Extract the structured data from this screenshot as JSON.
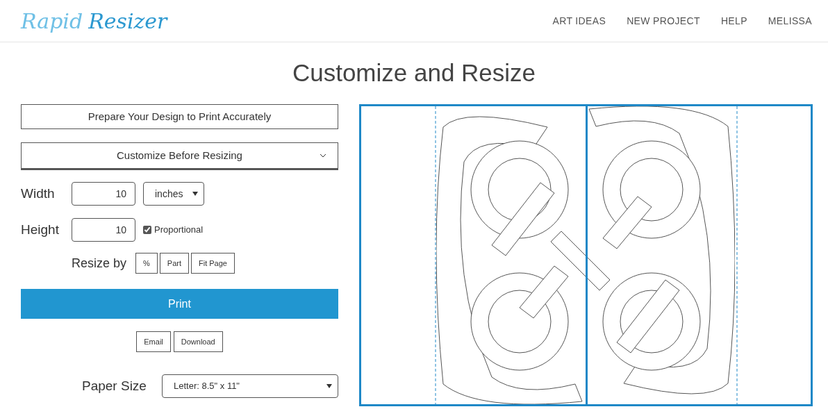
{
  "logo": {
    "word_1": "Rapid",
    "word_2": "Resizer"
  },
  "nav": [
    {
      "label": "ART IDEAS"
    },
    {
      "label": "NEW PROJECT"
    },
    {
      "label": "HELP"
    },
    {
      "label": "MELISSA"
    }
  ],
  "title": "Customize and Resize",
  "panels": [
    {
      "label": "Prepare Your Design to Print Accurately",
      "kind": "plain"
    },
    {
      "label": "Customize Before Resizing",
      "kind": "dropdown",
      "expanded": false
    }
  ],
  "width": {
    "label": "Width",
    "value": "10",
    "unit": "inches"
  },
  "height": {
    "label": "Height",
    "value": "10",
    "proportional": {
      "label": "Proportional",
      "checked": true
    }
  },
  "resize_by": {
    "label": "Resize by",
    "buttons": [
      "%",
      "Part",
      "Fit Page"
    ]
  },
  "print_button": "Print",
  "actions": [
    "Email",
    "Download"
  ],
  "paper_size": {
    "label": "Paper Size",
    "value": "Letter: 8.5\" x 11\""
  }
}
